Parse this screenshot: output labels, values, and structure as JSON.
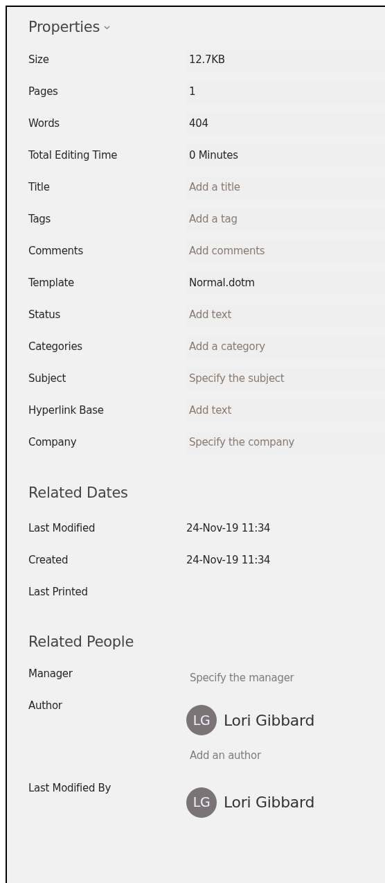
{
  "properties": {
    "title": "Properties",
    "items": [
      {
        "label": "Size",
        "value": "12.7KB"
      },
      {
        "label": "Pages",
        "value": "1"
      },
      {
        "label": "Words",
        "value": "404"
      },
      {
        "label": "Total Editing Time",
        "value": "0 Minutes"
      },
      {
        "label": "Title",
        "placeholder": "Add a title"
      },
      {
        "label": "Tags",
        "placeholder": "Add a tag"
      },
      {
        "label": "Comments",
        "placeholder": "Add comments"
      },
      {
        "label": "Template",
        "value": "Normal.dotm"
      },
      {
        "label": "Status",
        "placeholder": "Add text"
      },
      {
        "label": "Categories",
        "placeholder": "Add a category"
      },
      {
        "label": "Subject",
        "placeholder": "Specify the subject"
      },
      {
        "label": "Hyperlink Base",
        "placeholder": "Add text"
      },
      {
        "label": "Company",
        "placeholder": "Specify the company"
      }
    ]
  },
  "related_dates": {
    "title": "Related Dates",
    "items": [
      {
        "label": "Last Modified",
        "value": "24-Nov-19 11:34"
      },
      {
        "label": "Created",
        "value": "24-Nov-19 11:34"
      },
      {
        "label": "Last Printed"
      }
    ]
  },
  "related_people": {
    "title": "Related People",
    "items": [
      {
        "label": "Manager",
        "placeholder": "Specify the manager"
      },
      {
        "label": "Author",
        "person": {
          "initials": "LG",
          "name": "Lori Gibbard"
        },
        "add_link": "Add an author"
      },
      {
        "label": "Last Modified By",
        "person": {
          "initials": "LG",
          "name": "Lori Gibbard"
        }
      }
    ]
  }
}
